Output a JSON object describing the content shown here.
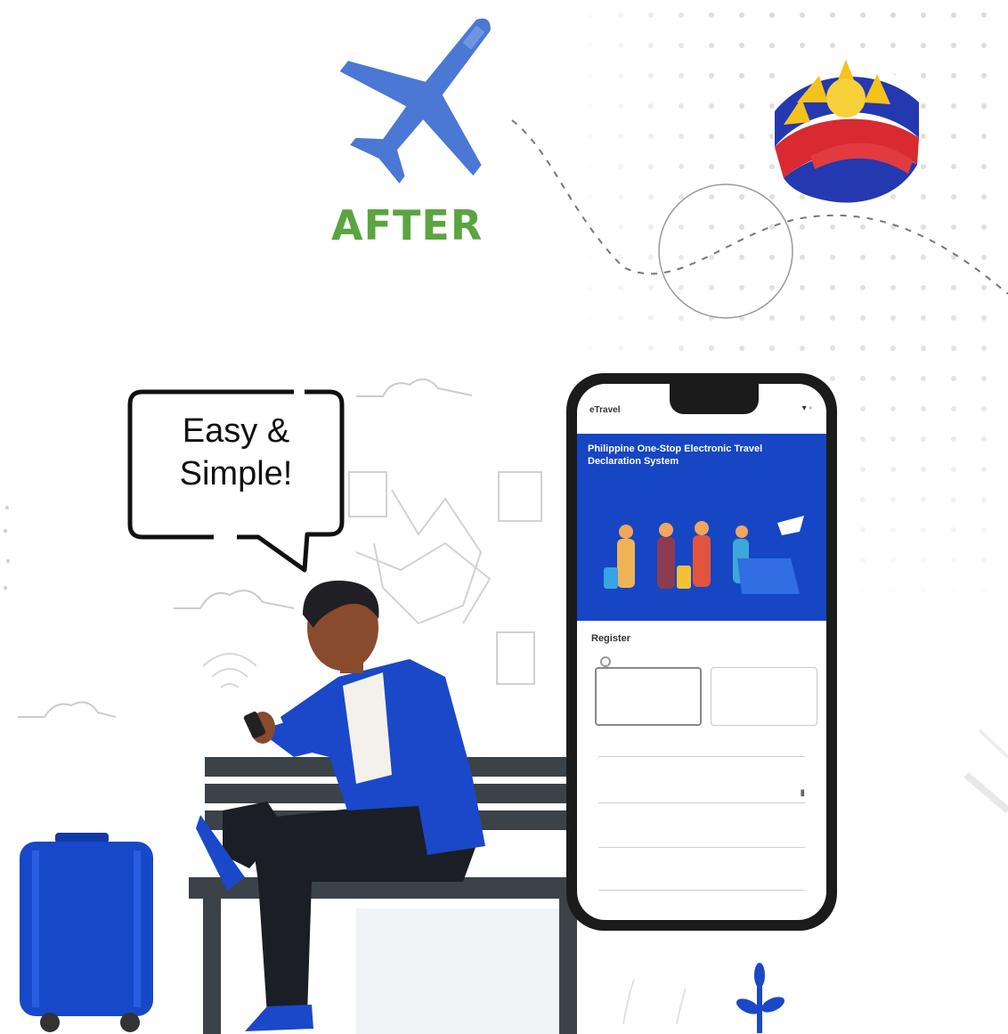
{
  "heading": "AFTER",
  "speech_bubble": {
    "line1": "Easy &",
    "line2": "Simple!"
  },
  "colors": {
    "heading_green": "#5aa540",
    "brand_blue": "#1646c4",
    "plane_blue": "#4a78d4",
    "phone_frame": "#1b1b1b"
  },
  "phone": {
    "status_logo": "eTravel",
    "status_icons": "▾ ◦",
    "hero_title": "Philippine One-Stop Electronic Travel Declaration System",
    "hero_subtitle": "",
    "form_title": "Register",
    "options": [
      {
        "label": "",
        "selected": true
      },
      {
        "label": "",
        "selected": false
      }
    ],
    "fields": [
      {
        "label": "",
        "icon": ""
      },
      {
        "label": "",
        "icon": "calendar-icon"
      },
      {
        "label": "",
        "icon": ""
      },
      {
        "label": "",
        "icon": ""
      }
    ],
    "consent_text": ""
  }
}
